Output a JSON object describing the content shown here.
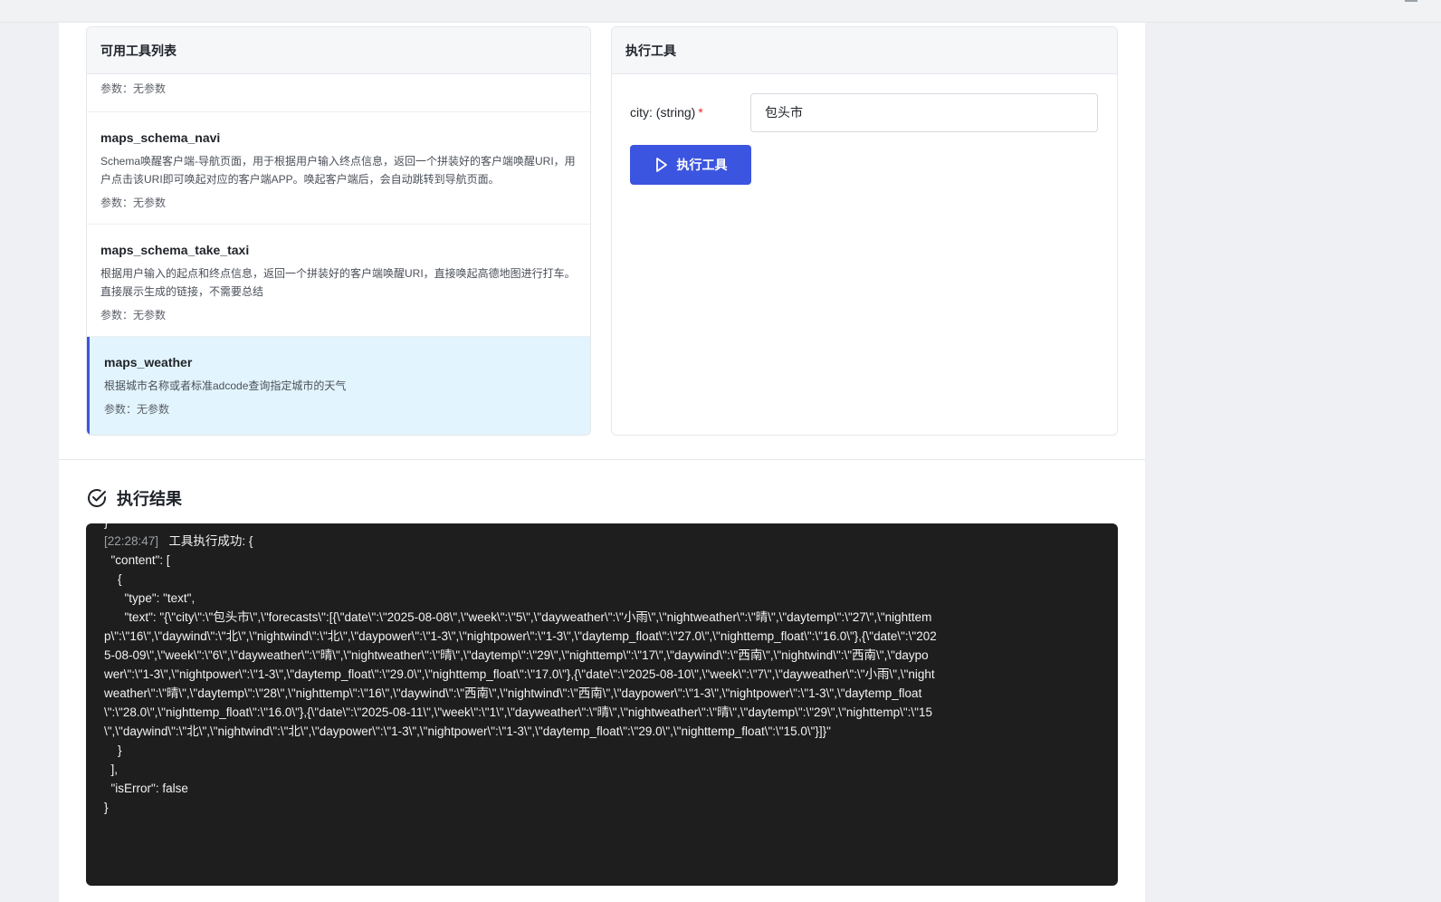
{
  "tool_list": {
    "title": "可用工具列表",
    "params_label": "参数：无参数",
    "items": [
      {
        "name": "maps_schema_navi",
        "description": "Schema唤醒客户端-导航页面，用于根据用户输入终点信息，返回一个拼装好的客户端唤醒URI，用户点击该URI即可唤起对应的客户端APP。唤起客户端后，会自动跳转到导航页面。",
        "params": "参数：无参数"
      },
      {
        "name": "maps_schema_take_taxi",
        "description": "根据用户输入的起点和终点信息，返回一个拼装好的客户端唤醒URI，直接唤起高德地图进行打车。直接展示生成的链接，不需要总结",
        "params": "参数：无参数"
      },
      {
        "name": "maps_weather",
        "description": "根据城市名称或者标准adcode查询指定城市的天气",
        "params": "参数：无参数"
      }
    ]
  },
  "executor": {
    "title": "执行工具",
    "field_label": "city: (string)",
    "required_mark": "*",
    "field_value": "包头市",
    "button_label": "执行工具"
  },
  "result": {
    "title": "执行结果",
    "prev_tail": "}",
    "timestamp": "[22:28:47]",
    "message": "工具执行成功: {\n  \"content\": [\n    {\n      \"type\": \"text\",\n      \"text\": \"{\\\"city\\\":\\\"包头市\\\",\\\"forecasts\\\":[{\\\"date\\\":\\\"2025-08-08\\\",\\\"week\\\":\\\"5\\\",\\\"dayweather\\\":\\\"小雨\\\",\\\"nightweather\\\":\\\"晴\\\",\\\"daytemp\\\":\\\"27\\\",\\\"nighttemp\\\":\\\"16\\\",\\\"daywind\\\":\\\"北\\\",\\\"nightwind\\\":\\\"北\\\",\\\"daypower\\\":\\\"1-3\\\",\\\"nightpower\\\":\\\"1-3\\\",\\\"daytemp_float\\\":\\\"27.0\\\",\\\"nighttemp_float\\\":\\\"16.0\\\"},{\\\"date\\\":\\\"2025-08-09\\\",\\\"week\\\":\\\"6\\\",\\\"dayweather\\\":\\\"晴\\\",\\\"nightweather\\\":\\\"晴\\\",\\\"daytemp\\\":\\\"29\\\",\\\"nighttemp\\\":\\\"17\\\",\\\"daywind\\\":\\\"西南\\\",\\\"nightwind\\\":\\\"西南\\\",\\\"daypower\\\":\\\"1-3\\\",\\\"nightpower\\\":\\\"1-3\\\",\\\"daytemp_float\\\":\\\"29.0\\\",\\\"nighttemp_float\\\":\\\"17.0\\\"},{\\\"date\\\":\\\"2025-08-10\\\",\\\"week\\\":\\\"7\\\",\\\"dayweather\\\":\\\"小雨\\\",\\\"nightweather\\\":\\\"晴\\\",\\\"daytemp\\\":\\\"28\\\",\\\"nighttemp\\\":\\\"16\\\",\\\"daywind\\\":\\\"西南\\\",\\\"nightwind\\\":\\\"西南\\\",\\\"daypower\\\":\\\"1-3\\\",\\\"nightpower\\\":\\\"1-3\\\",\\\"daytemp_float\\\":\\\"28.0\\\",\\\"nighttemp_float\\\":\\\"16.0\\\"},{\\\"date\\\":\\\"2025-08-11\\\",\\\"week\\\":\\\"1\\\",\\\"dayweather\\\":\\\"晴\\\",\\\"nightweather\\\":\\\"晴\\\",\\\"daytemp\\\":\\\"29\\\",\\\"nighttemp\\\":\\\"15\\\",\\\"daywind\\\":\\\"北\\\",\\\"nightwind\\\":\\\"北\\\",\\\"daypower\\\":\\\"1-3\\\",\\\"nightpower\\\":\\\"1-3\\\",\\\"daytemp_float\\\":\\\"29.0\\\",\\\"nighttemp_float\\\":\\\"15.0\\\"}]}\"\n    }\n  ],\n  \"isError\": false\n}"
  },
  "colors": {
    "accent": "#3c55e0",
    "selected_bg": "#e2f4fd",
    "console_bg": "#1e1e1e",
    "required": "#e02b2b"
  }
}
